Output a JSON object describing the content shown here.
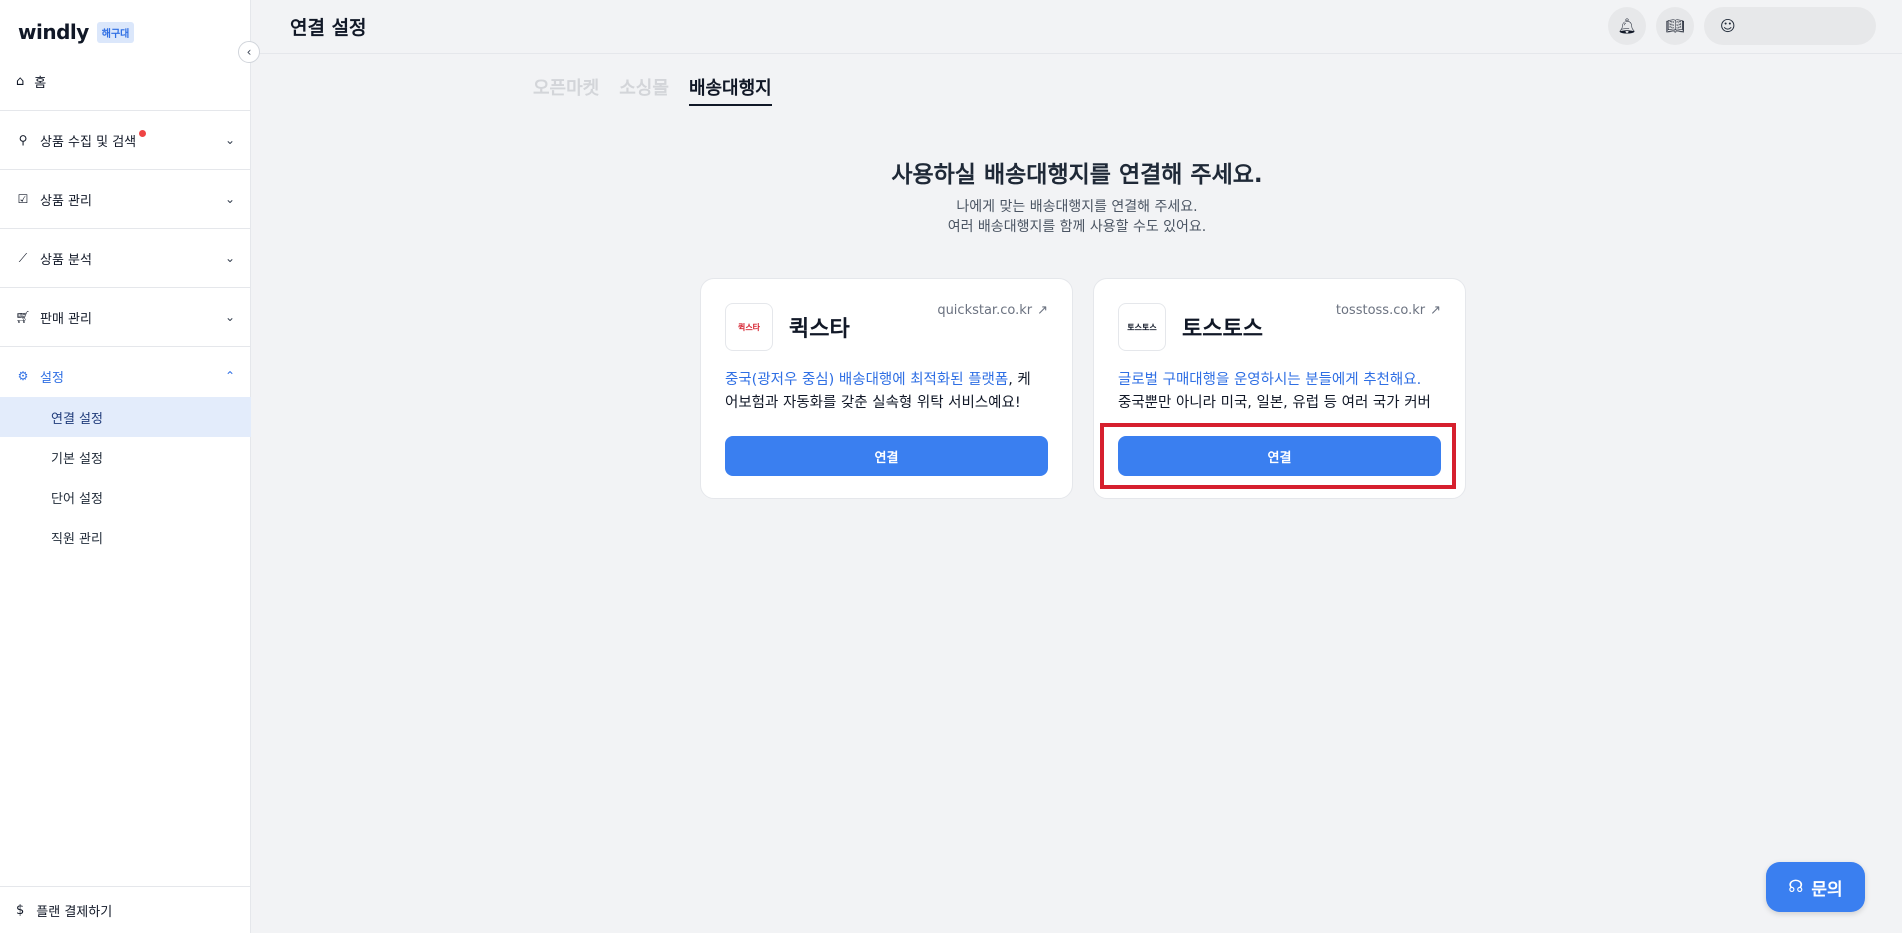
{
  "sidebar": {
    "logo": "windly",
    "badge": "해구대",
    "home": "홈",
    "sections": [
      {
        "label": "상품 수집 및 검색"
      },
      {
        "label": "상품 관리"
      },
      {
        "label": "상품 분석"
      },
      {
        "label": "판매 관리"
      },
      {
        "label": "설정"
      }
    ],
    "settings_items": [
      {
        "label": "연결 설정"
      },
      {
        "label": "기본 설정"
      },
      {
        "label": "단어 설정"
      },
      {
        "label": "직원 관리"
      }
    ],
    "plan": "플랜 결제하기"
  },
  "header": {
    "title": "연결 설정"
  },
  "tabs": [
    {
      "label": "오픈마켓"
    },
    {
      "label": "소싱몰"
    },
    {
      "label": "배송대행지"
    }
  ],
  "main": {
    "heading": "사용하실 배송대행지를 연결해 주세요.",
    "sub1": "나에게 맞는 배송대행지를 연결해 주세요.",
    "sub2": "여러 배송대행지를 함께 사용할 수도 있어요."
  },
  "cards": [
    {
      "name": "퀵스타",
      "logo_text": "퀵스타",
      "url": "quickstar.co.kr",
      "desc_highlight": "중국(광저우 중심) 배송대행에 최적화된 플랫폼",
      "desc_rest": ", 케",
      "desc_line2": "어보험과 자동화를 갖춘 실속형 위탁 서비스예요!",
      "button": "연결"
    },
    {
      "name": "토스토스",
      "logo_text": "토스토스",
      "url": "tosstoss.co.kr",
      "desc_highlight": "글로벌 구매대행을 운영하시는 분들에게 추천해요.",
      "desc_rest": "",
      "desc_line2": "중국뿐만 아니라 미국, 일본, 유럽 등 여러 국가 커버",
      "button": "연결"
    }
  ],
  "inquiry": "문의",
  "colors": {
    "accent": "#3a7ff0",
    "highlight_box": "#d6202e",
    "notification_dot": "#ef4444"
  }
}
